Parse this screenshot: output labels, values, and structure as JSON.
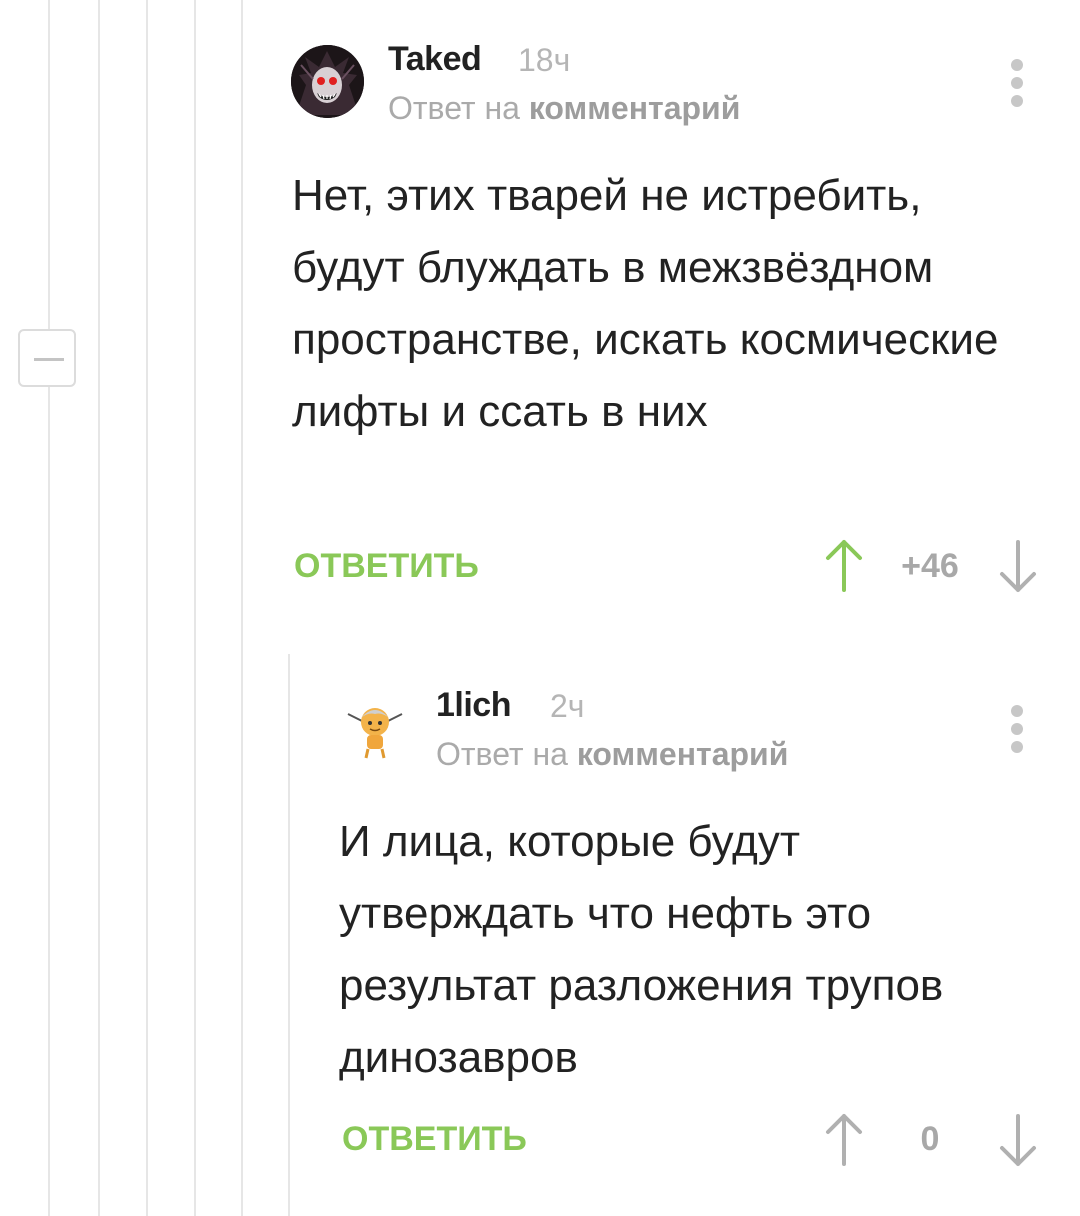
{
  "colors": {
    "accent": "#8ac858",
    "text": "#222222",
    "muted": "#aaaaaa",
    "thread_line": "#e6e6e6"
  },
  "comments": [
    {
      "username": "Taked",
      "time": "18ч",
      "reply_prefix": "Ответ на",
      "reply_link": "комментарий",
      "text": "Нет, этих тварей не истребить, будут блуждать в межзвёздном пространстве, искать космические лифты и ссать в них",
      "reply_label": "ОТВЕТИТЬ",
      "rating": "+46",
      "upvoted": true,
      "avatar_icon": "dark-creature-avatar"
    },
    {
      "username": "1lich",
      "time": "2ч",
      "reply_prefix": "Ответ на",
      "reply_link": "комментарий",
      "text": "И лица, которые будут утверждать что нефть это результат разложения трупов динозавров",
      "reply_label": "ОТВЕТИТЬ",
      "rating": "0",
      "upvoted": false,
      "avatar_icon": "cartoon-character-avatar"
    }
  ],
  "icons": {
    "collapse": "minus-icon",
    "more": "more-vertical-icon",
    "upvote": "arrow-up-icon",
    "downvote": "arrow-down-icon"
  }
}
